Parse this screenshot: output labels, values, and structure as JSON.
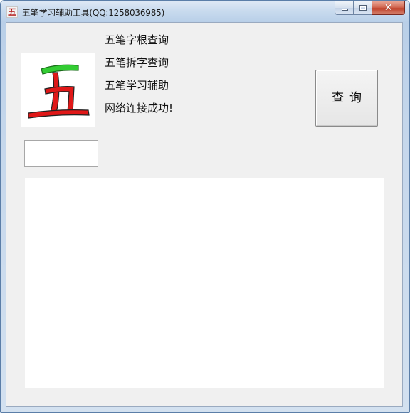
{
  "window": {
    "title": "五笔学习辅助工具(QQ:1258036985)",
    "icon_glyph": "五",
    "icon_name": "wubi-app-icon"
  },
  "caption_buttons": {
    "minimize": "minimize-icon",
    "maximize": "maximize-icon",
    "close_glyph": "✕"
  },
  "logo": {
    "glyph": "五",
    "icon_name": "wubi-logo-icon",
    "colors": {
      "top_stroke": "#33cc33",
      "body": "#e01818",
      "outline": "#222222"
    }
  },
  "menu": {
    "items": [
      {
        "label": "五笔字根查询"
      },
      {
        "label": "五笔拆字查询"
      },
      {
        "label": "五笔学习辅助"
      }
    ],
    "status": "网络连接成功!"
  },
  "query_button": {
    "label": "查询"
  },
  "search": {
    "value": "",
    "placeholder": ""
  },
  "result": {
    "text": ""
  }
}
